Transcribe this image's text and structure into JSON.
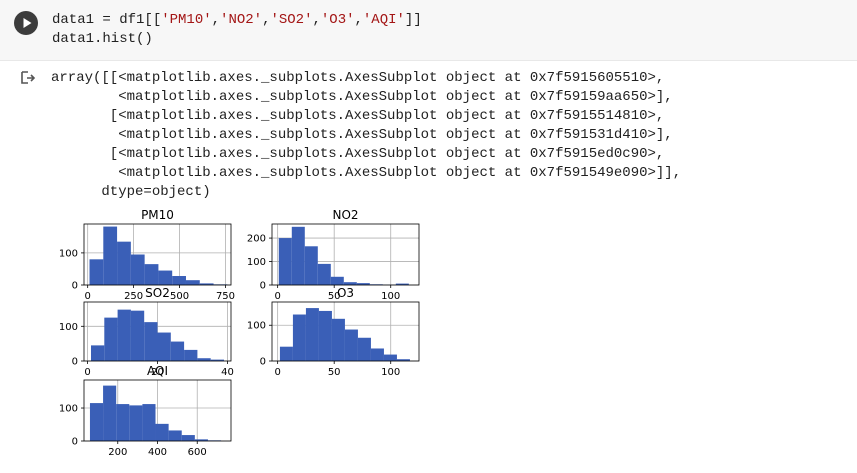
{
  "code": {
    "line1_pre": "data1 = df1[[",
    "line1_s1": "'PM10'",
    "line1_s2": "'NO2'",
    "line1_s3": "'SO2'",
    "line1_s4": "'O3'",
    "line1_s5": "'AQI'",
    "line1_post": "]]",
    "sep": ",",
    "line2": "data1.hist()"
  },
  "output": {
    "lines": [
      "array([[<matplotlib.axes._subplots.AxesSubplot object at 0x7f5915605510>,",
      "        <matplotlib.axes._subplots.AxesSubplot object at 0x7f59159aa650>],",
      "       [<matplotlib.axes._subplots.AxesSubplot object at 0x7f5915514810>,",
      "        <matplotlib.axes._subplots.AxesSubplot object at 0x7f591531d410>],",
      "       [<matplotlib.axes._subplots.AxesSubplot object at 0x7f5915ed0c90>,",
      "        <matplotlib.axes._subplots.AxesSubplot object at 0x7f591549e090>]],",
      "      dtype=object)"
    ]
  },
  "colors": {
    "bar": "#3a5fb7",
    "grid": "#b0b0b0"
  },
  "chart_data": [
    {
      "type": "bar",
      "title": "PM10",
      "xlim": [
        -20,
        780
      ],
      "ylim": [
        0,
        190
      ],
      "xticks": [
        0,
        250,
        500,
        750
      ],
      "yticks": [
        0,
        100
      ],
      "bins": [
        [
          10,
          85
        ],
        [
          85,
          160
        ],
        [
          160,
          235
        ],
        [
          235,
          310
        ],
        [
          310,
          385
        ],
        [
          385,
          460
        ],
        [
          460,
          535
        ],
        [
          535,
          610
        ],
        [
          610,
          685
        ],
        [
          685,
          760
        ]
      ],
      "values": [
        80,
        182,
        135,
        95,
        65,
        45,
        28,
        15,
        5,
        2
      ]
    },
    {
      "type": "bar",
      "title": "NO2",
      "xlim": [
        -5,
        125
      ],
      "ylim": [
        0,
        260
      ],
      "xticks": [
        0,
        50,
        100
      ],
      "yticks": [
        0,
        100,
        200
      ],
      "bins": [
        [
          1,
          12.5
        ],
        [
          12.5,
          24
        ],
        [
          24,
          35.5
        ],
        [
          35.5,
          47
        ],
        [
          47,
          58.5
        ],
        [
          58.5,
          70
        ],
        [
          70,
          81.5
        ],
        [
          81.5,
          93
        ],
        [
          93,
          104.5
        ],
        [
          104.5,
          116
        ]
      ],
      "values": [
        200,
        248,
        165,
        90,
        35,
        12,
        8,
        3,
        1,
        6
      ]
    },
    {
      "type": "bar",
      "title": "SO2",
      "xlim": [
        -1,
        41
      ],
      "ylim": [
        0,
        170
      ],
      "xticks": [
        0,
        20,
        40
      ],
      "yticks": [
        0,
        100
      ],
      "bins": [
        [
          1,
          4.8
        ],
        [
          4.8,
          8.6
        ],
        [
          8.6,
          12.4
        ],
        [
          12.4,
          16.2
        ],
        [
          16.2,
          20
        ],
        [
          20,
          23.8
        ],
        [
          23.8,
          27.6
        ],
        [
          27.6,
          31.4
        ],
        [
          31.4,
          35.2
        ],
        [
          35.2,
          39
        ]
      ],
      "values": [
        45,
        125,
        148,
        145,
        112,
        82,
        56,
        32,
        8,
        4
      ]
    },
    {
      "type": "bar",
      "title": "O3",
      "xlim": [
        -5,
        125
      ],
      "ylim": [
        0,
        165
      ],
      "xticks": [
        0,
        50,
        100
      ],
      "yticks": [
        0,
        100
      ],
      "bins": [
        [
          2,
          13.5
        ],
        [
          13.5,
          25
        ],
        [
          25,
          36.5
        ],
        [
          36.5,
          48
        ],
        [
          48,
          59.5
        ],
        [
          59.5,
          71
        ],
        [
          71,
          82.5
        ],
        [
          82.5,
          94
        ],
        [
          94,
          105.5
        ],
        [
          105.5,
          117
        ]
      ],
      "values": [
        40,
        130,
        148,
        140,
        118,
        88,
        65,
        35,
        18,
        5
      ]
    },
    {
      "type": "bar",
      "title": "AQI",
      "xlim": [
        30,
        770
      ],
      "ylim": [
        0,
        185
      ],
      "xticks": [
        200,
        400,
        600
      ],
      "yticks": [
        0,
        100
      ],
      "bins": [
        [
          60,
          126
        ],
        [
          126,
          192
        ],
        [
          192,
          258
        ],
        [
          258,
          324
        ],
        [
          324,
          390
        ],
        [
          390,
          456
        ],
        [
          456,
          522
        ],
        [
          522,
          588
        ],
        [
          588,
          654
        ],
        [
          654,
          720
        ]
      ],
      "values": [
        115,
        168,
        112,
        108,
        112,
        52,
        32,
        18,
        5,
        2
      ]
    }
  ]
}
